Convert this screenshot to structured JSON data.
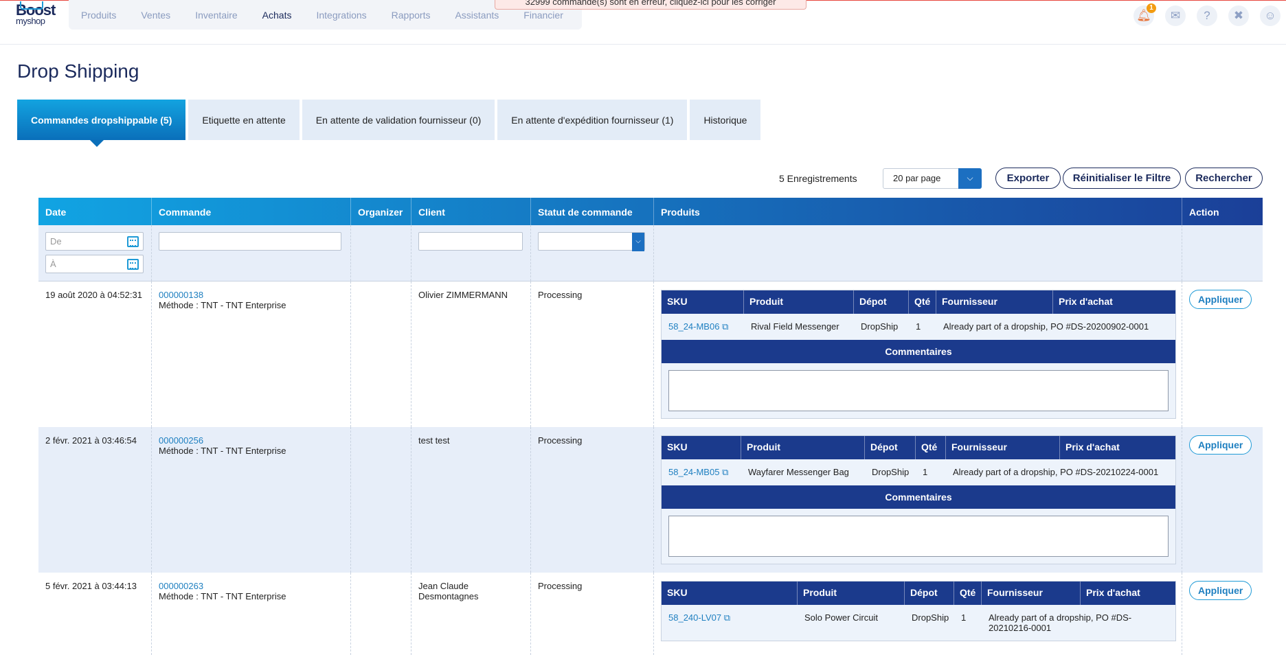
{
  "banner": {
    "text": "32999 commande(s) sont en erreur, cliquez-ici pour les corriger"
  },
  "logo": {
    "line1": "Boost",
    "line2": "myshop"
  },
  "nav": [
    "Produits",
    "Ventes",
    "Inventaire",
    "Achats",
    "Integrations",
    "Rapports",
    "Assistants",
    "Financier"
  ],
  "nav_active": "Achats",
  "notifications": {
    "count": "1"
  },
  "page": {
    "title": "Drop Shipping"
  },
  "tabs": [
    "Commandes dropshippable (5)",
    "Etiquette en attente",
    "En attente de validation fournisseur (0)",
    "En attente d'expédition fournisseur (1)",
    "Historique"
  ],
  "toolbar": {
    "records": "5 Enregistrements",
    "per_page": "20 par page",
    "export": "Exporter",
    "reset": "Réinitialiser le Filtre",
    "search": "Rechercher"
  },
  "columns": [
    "Date",
    "Commande",
    "Organizer",
    "Client",
    "Statut de commande",
    "Produits",
    "Action"
  ],
  "filters": {
    "date_from": "De",
    "date_to": "À"
  },
  "product_columns": [
    "SKU",
    "Produit",
    "Dépot",
    "Qté",
    "Fournisseur",
    "Prix d'achat"
  ],
  "comments_label": "Commentaires",
  "apply_label": "Appliquer",
  "rows": [
    {
      "date": "19 août 2020 à 04:52:31",
      "order": "000000138",
      "method": "Méthode : TNT - TNT Enterprise",
      "client": "Olivier ZIMMERMANN",
      "status": "Processing",
      "product": {
        "sku": "58_24-MB06",
        "name": "Rival Field Messenger",
        "depot": "DropShip",
        "qty": "1",
        "supplier": "Already part of a dropship, PO #DS-20200902-0001"
      }
    },
    {
      "date": "2 févr. 2021 à 03:46:54",
      "order": "000000256",
      "method": "Méthode : TNT - TNT Enterprise",
      "client": "test test",
      "status": "Processing",
      "product": {
        "sku": "58_24-MB05",
        "name": "Wayfarer Messenger Bag",
        "depot": "DropShip",
        "qty": "1",
        "supplier": "Already part of a dropship, PO #DS-20210224-0001"
      }
    },
    {
      "date": "5 févr. 2021 à 03:44:13",
      "order": "000000263",
      "method": "Méthode : TNT - TNT Enterprise",
      "client": "Jean Claude Desmontagnes",
      "status": "Processing",
      "product": {
        "sku": "58_240-LV07",
        "name": "Solo Power Circuit",
        "depot": "DropShip",
        "qty": "1",
        "supplier": "Already part of a dropship, PO #DS-20210216-0001"
      }
    }
  ]
}
